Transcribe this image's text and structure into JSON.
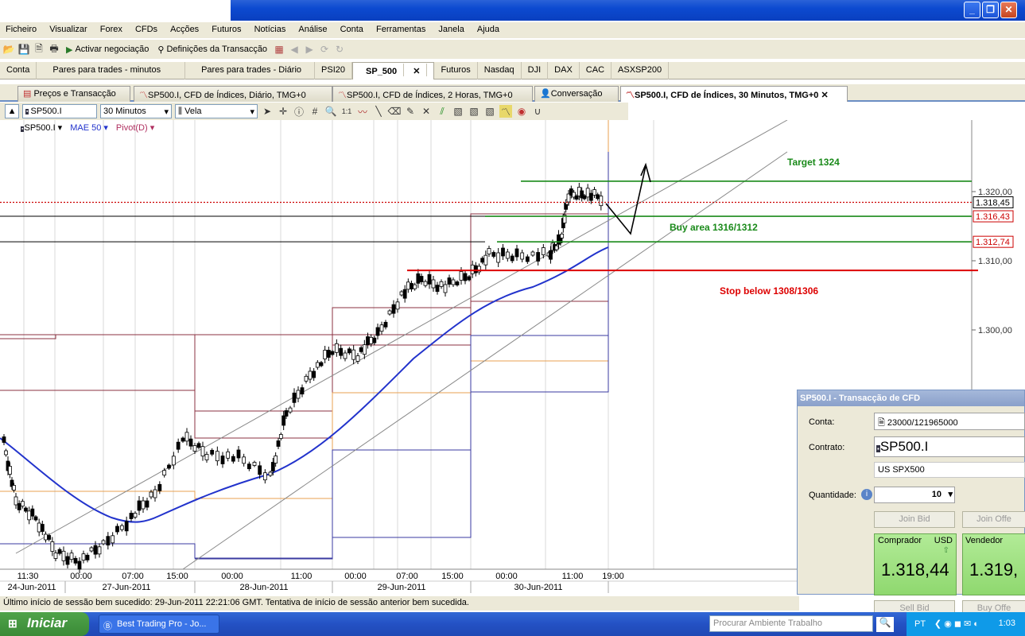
{
  "menu": [
    "Ficheiro",
    "Visualizar",
    "Forex",
    "CFDs",
    "Acções",
    "Futuros",
    "Notícias",
    "Análise",
    "Conta",
    "Ferramentas",
    "Janela",
    "Ajuda"
  ],
  "toolbar": {
    "activate": "Activar negociação",
    "definitions": "Definições da Transacção"
  },
  "tabs_top": [
    {
      "label": "Conta"
    },
    {
      "label": "Pares para trades - minutos"
    },
    {
      "label": "Pares para trades - Diário"
    },
    {
      "label": "PSI20"
    },
    {
      "label": "SP_500",
      "active": true,
      "closable": "✕"
    },
    {
      "label": "Futuros"
    },
    {
      "label": "Nasdaq"
    },
    {
      "label": "DJI"
    },
    {
      "label": "DAX"
    },
    {
      "label": "CAC"
    },
    {
      "label": "ASXSP200"
    }
  ],
  "tabs_window": [
    {
      "label": "Preços e Transacção"
    },
    {
      "label": "SP500.I, CFD de Índices, Diário, TMG+0"
    },
    {
      "label": "SP500.I, CFD de Índices, 2 Horas, TMG+0"
    },
    {
      "label": "Conversação"
    },
    {
      "label": "SP500.I, CFD de Índices, 30 Minutos, TMG+0",
      "active": true,
      "closable": "✕"
    }
  ],
  "chart_toolbar": {
    "symbol": "SP500.I",
    "timeframe": "30 Minutos",
    "chart_style": "Vela"
  },
  "chart_legend": {
    "symbol": "SP500.I",
    "indicator1": "MAE 50",
    "indicator2": "Pivot(D)"
  },
  "chart_data": {
    "type": "line",
    "title": "",
    "price_axis": {
      "ticks": [
        "1.320,00",
        "1.310,00",
        "1.300,00"
      ],
      "ylim": [
        1288,
        1322
      ]
    },
    "price_markers": [
      {
        "label": "1.318,45",
        "value": 1318.45,
        "style": "current"
      },
      {
        "label": "1.316,43",
        "value": 1316.43,
        "color": "#cc0000"
      },
      {
        "label": "1.312,74",
        "value": 1312.74,
        "color": "#cc0000"
      }
    ],
    "time_ticks": [
      "11:30",
      "00:00",
      "07:00",
      "15:00",
      "00:00",
      "11:00",
      "00:00",
      "07:00",
      "15:00",
      "00:00",
      "11:00",
      "19:00"
    ],
    "date_ticks": [
      "24-Jun-2011",
      "27-Jun-2011",
      "28-Jun-2011",
      "29-Jun-2011",
      "30-Jun-2011"
    ],
    "annotations": [
      {
        "text": "Target 1324",
        "color": "#1a8a1a",
        "value": 1321.5
      },
      {
        "text": "Buy area 1316/1312",
        "color": "#1a8a1a",
        "value": 1316.43
      },
      {
        "text": "Stop below 1308/1306",
        "color": "#dd0000",
        "value": 1308.6
      }
    ],
    "horizontal_lines": [
      {
        "value": 1321.5,
        "color": "#1a8a1a"
      },
      {
        "value": 1316.43,
        "color": "#1a8a1a"
      },
      {
        "value": 1312.74,
        "color": "#1a8a1a"
      },
      {
        "value": 1308.6,
        "color": "#dd0000"
      },
      {
        "value": 1318.45,
        "color": "#cc0000",
        "style": "dotted"
      }
    ]
  },
  "statusbar": "Último início de sessão bem sucedido: 29-Jun-2011 22:21:06 GMT. Tentativa de início de sessão anterior bem sucedida.",
  "panel": {
    "title": "SP500.I - Transacção de CFD",
    "conta_label": "Conta:",
    "conta_value": "23000/121965000",
    "contrato_label": "Contrato:",
    "contrato_value": "SP500.I",
    "contrato_desc": "US SPX500",
    "quantidade_label": "Quantidade:",
    "quantidade_value": "10",
    "join_bid": "Join Bid",
    "join_offer": "Join Offe",
    "comprador": "Comprador",
    "currency": "USD",
    "comprador_price": "1.318,44",
    "vendedor": "Vendedor",
    "vendedor_price": "1.319,",
    "sell_bid": "Sell Bid",
    "buy_offer": "Buy Offe"
  },
  "taskbar": {
    "start": "Iniciar",
    "task": "Best Trading Pro - Jo...",
    "search_placeholder": "Procurar Ambiente Trabalho",
    "lang": "PT",
    "time": "1:03"
  }
}
